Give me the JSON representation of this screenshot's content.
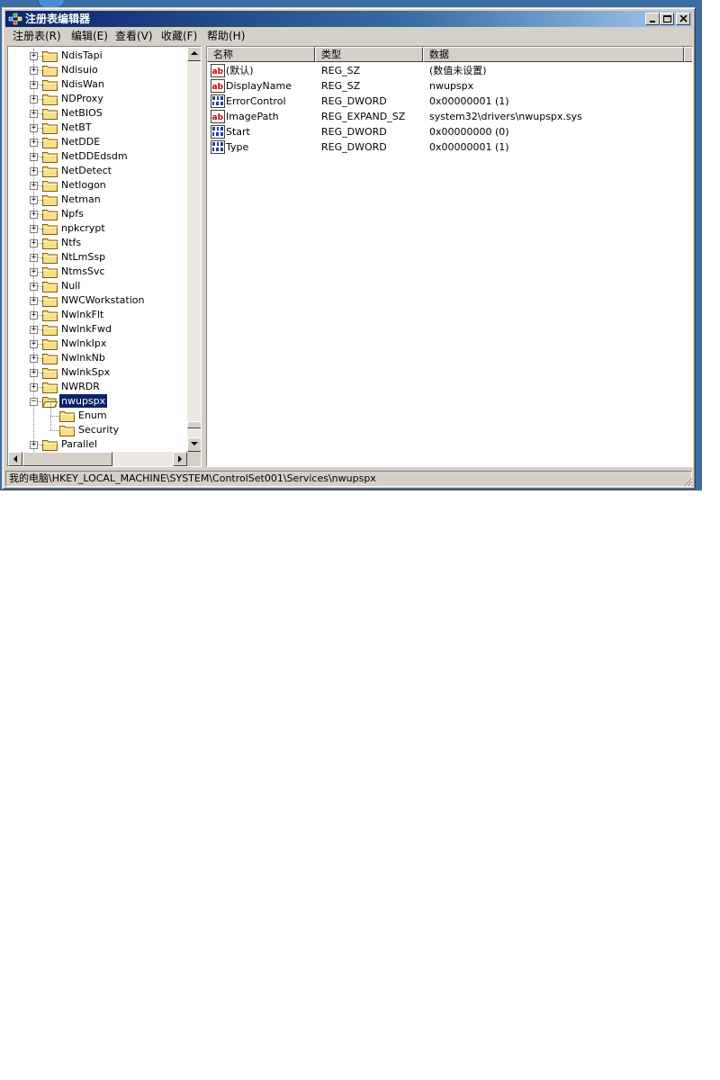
{
  "window": {
    "title": "注册表编辑器"
  },
  "menu": [
    {
      "label": "注册表(R)"
    },
    {
      "label": "编辑(E)"
    },
    {
      "label": "查看(V)"
    },
    {
      "label": "收藏(F)"
    },
    {
      "label": "帮助(H)"
    }
  ],
  "tree": {
    "items": [
      {
        "label": "NdisTapi",
        "expander": "+"
      },
      {
        "label": "Ndisuio",
        "expander": "+"
      },
      {
        "label": "NdisWan",
        "expander": "+"
      },
      {
        "label": "NDProxy",
        "expander": "+"
      },
      {
        "label": "NetBIOS",
        "expander": "+"
      },
      {
        "label": "NetBT",
        "expander": "+"
      },
      {
        "label": "NetDDE",
        "expander": "+"
      },
      {
        "label": "NetDDEdsdm",
        "expander": "+"
      },
      {
        "label": "NetDetect",
        "expander": "+"
      },
      {
        "label": "Netlogon",
        "expander": "+"
      },
      {
        "label": "Netman",
        "expander": "+"
      },
      {
        "label": "Npfs",
        "expander": "+"
      },
      {
        "label": "npkcrypt",
        "expander": "+"
      },
      {
        "label": "Ntfs",
        "expander": "+"
      },
      {
        "label": "NtLmSsp",
        "expander": "+"
      },
      {
        "label": "NtmsSvc",
        "expander": "+"
      },
      {
        "label": "Null",
        "expander": "+"
      },
      {
        "label": "NWCWorkstation",
        "expander": "+"
      },
      {
        "label": "NwlnkFlt",
        "expander": "+"
      },
      {
        "label": "NwlnkFwd",
        "expander": "+"
      },
      {
        "label": "NwlnkIpx",
        "expander": "+"
      },
      {
        "label": "NwlnkNb",
        "expander": "+"
      },
      {
        "label": "NwlnkSpx",
        "expander": "+"
      },
      {
        "label": "NWRDR",
        "expander": "+"
      },
      {
        "label": "nwupspx",
        "expander": "−"
      },
      {
        "label": "Enum"
      },
      {
        "label": "Security"
      },
      {
        "label": "Parallel",
        "expander": "+"
      }
    ]
  },
  "list": {
    "columns": [
      "名称",
      "类型",
      "数据"
    ],
    "rows": [
      {
        "icon": "string-value-icon",
        "name": "(默认)",
        "type": "REG_SZ",
        "data": "(数值未设置)"
      },
      {
        "icon": "string-value-icon",
        "name": "DisplayName",
        "type": "REG_SZ",
        "data": "nwupspx"
      },
      {
        "icon": "binary-value-icon",
        "name": "ErrorControl",
        "type": "REG_DWORD",
        "data": "0x00000001 (1)"
      },
      {
        "icon": "string-value-icon",
        "name": "ImagePath",
        "type": "REG_EXPAND_SZ",
        "data": "system32\\drivers\\nwupspx.sys"
      },
      {
        "icon": "binary-value-icon",
        "name": "Start",
        "type": "REG_DWORD",
        "data": "0x00000000 (0)"
      },
      {
        "icon": "binary-value-icon",
        "name": "Type",
        "type": "REG_DWORD",
        "data": "0x00000001 (1)"
      }
    ]
  },
  "status": {
    "path": "我的电脑\\HKEY_LOCAL_MACHINE\\SYSTEM\\ControlSet001\\Services\\nwupspx"
  },
  "colors": {
    "selection": "#0a246a",
    "titlebar_start": "#0a246a",
    "face": "#d4d0c8",
    "folder": "#f5e08a"
  }
}
